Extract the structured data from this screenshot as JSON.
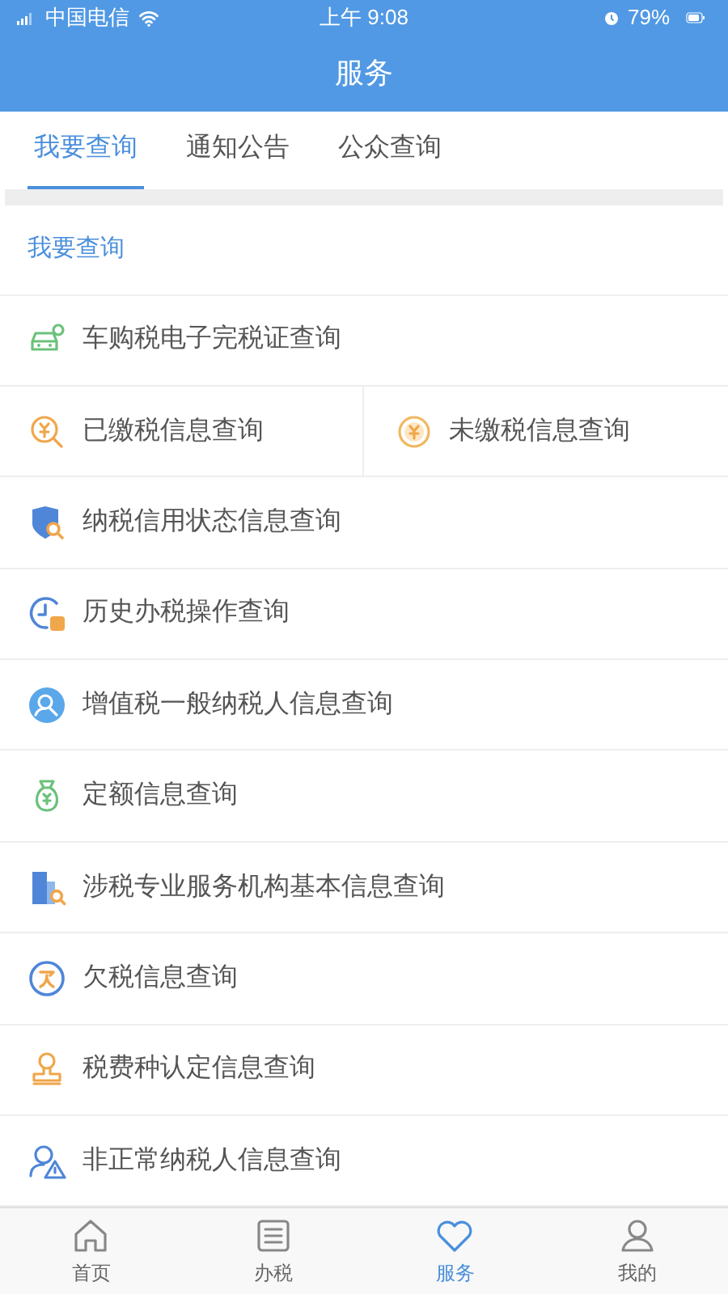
{
  "status_bar": {
    "carrier": "中国电信",
    "time": "上午 9:08",
    "battery": "79%"
  },
  "header": {
    "title": "服务"
  },
  "tabs": [
    {
      "label": "我要查询",
      "selected": true
    },
    {
      "label": "通知公告",
      "selected": false
    },
    {
      "label": "公众查询",
      "selected": false
    }
  ],
  "section": {
    "title": "我要查询"
  },
  "rows": [
    [
      {
        "label": "车购税电子完税证查询"
      }
    ],
    [
      {
        "label": "已缴税信息查询"
      },
      {
        "label": "未缴税信息查询"
      }
    ],
    [
      {
        "label": "纳税信用状态信息查询"
      }
    ],
    [
      {
        "label": "历史办税操作查询"
      }
    ],
    [
      {
        "label": "增值税一般纳税人信息查询"
      }
    ],
    [
      {
        "label": "定额信息查询"
      }
    ],
    [
      {
        "label": "涉税专业服务机构基本信息查询"
      }
    ],
    [
      {
        "label": "欠税信息查询"
      }
    ],
    [
      {
        "label": "税费种认定信息查询"
      }
    ],
    [
      {
        "label": "非正常纳税人信息查询"
      }
    ]
  ],
  "tab_bar": [
    {
      "label": "首页",
      "selected": false
    },
    {
      "label": "办税",
      "selected": false
    },
    {
      "label": "服务",
      "selected": true
    },
    {
      "label": "我的",
      "selected": false
    }
  ]
}
